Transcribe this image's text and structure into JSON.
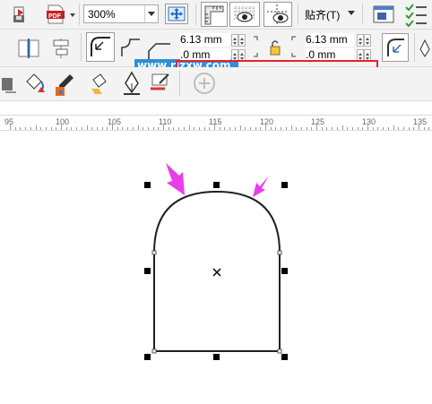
{
  "toolbar": {
    "zoom_value": "300%",
    "snap_label": "贴齐(T)"
  },
  "watermark": {
    "text": "www.rjzxw.com"
  },
  "property_bar": {
    "corner_size_1": "6.13 mm",
    "corner_size_2": ".0 mm",
    "corner_size_3": "6.13 mm",
    "corner_size_4": ".0 mm"
  },
  "ruler": {
    "labels": [
      "95",
      "100",
      "105",
      "110",
      "115",
      "120",
      "125",
      "130",
      "135"
    ]
  },
  "colors": {
    "annotation_arrow": "#e83ee8",
    "highlight_box": "#e8212b",
    "watermark_bg": "#2f8fd6",
    "shape_stroke": "#000000"
  },
  "icons": [
    "save-icon",
    "export-pdf-icon",
    "publish-icon",
    "full-screen-icon",
    "rulers-icon",
    "wireframe-view-icon",
    "grid-icon",
    "guidelines-icon",
    "options-icon",
    "checklist-icon",
    "object-origin-icon",
    "align-icon",
    "round-corner-icon",
    "scalloped-corner-icon",
    "lock-ratio-icon",
    "relative-corner-scaling-icon",
    "fill-icon",
    "eyedropper-icon",
    "pen-icon",
    "outline-icon",
    "add-icon"
  ]
}
